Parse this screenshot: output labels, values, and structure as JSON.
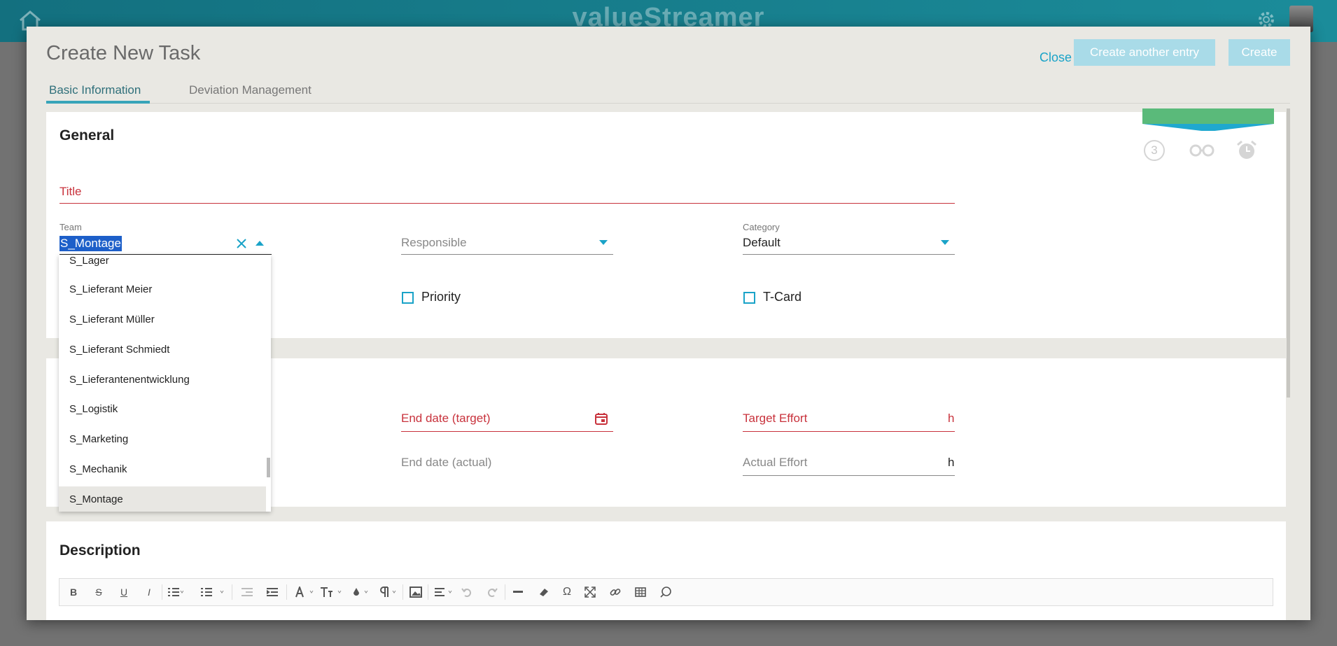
{
  "app": {
    "brand": "valueStreamer"
  },
  "modal": {
    "title": "Create New Task",
    "close_label": "Close",
    "create_another_label": "Create another entry",
    "create_label": "Create"
  },
  "tabs": [
    {
      "label": "Basic Information",
      "active": true
    },
    {
      "label": "Deviation Management",
      "active": false
    }
  ],
  "general": {
    "section_title": "General",
    "status_count": "3",
    "title_placeholder": "Title",
    "team_label": "Team",
    "team_value": "S_Montage",
    "responsible_placeholder": "Responsible",
    "category_label": "Category",
    "category_value": "Default",
    "priority_label": "Priority",
    "priority_checked": false,
    "tcard_label": "T-Card",
    "tcard_checked": false
  },
  "team_dropdown": {
    "options": [
      "S_Lager",
      "S_Lieferant Meier",
      "S_Lieferant Müller",
      "S_Lieferant Schmiedt",
      "S_Lieferantenentwicklung",
      "S_Logistik",
      "S_Marketing",
      "S_Mechanik",
      "S_Montage"
    ],
    "selected": "S_Montage"
  },
  "dates": {
    "end_target_placeholder": "End date (target)",
    "target_effort_placeholder": "Target Effort",
    "target_effort_unit": "h",
    "end_actual_placeholder": "End date (actual)",
    "actual_effort_placeholder": "Actual Effort",
    "actual_effort_unit": "h"
  },
  "description": {
    "section_title": "Description",
    "toolbar": {
      "bold": "B",
      "strike": "S",
      "underline": "U",
      "italic": "I",
      "special_char": "Ω"
    }
  },
  "colors": {
    "accent": "#1aa3c8",
    "required": "#c8323c",
    "ribbon_green": "#5aba7a",
    "header_teal": "#13707f"
  },
  "icons": [
    "home-icon",
    "gear-icon",
    "glasses-icon",
    "alarm-clock-icon",
    "clear-icon",
    "caret-up-icon",
    "caret-down-icon",
    "calendar-icon"
  ]
}
